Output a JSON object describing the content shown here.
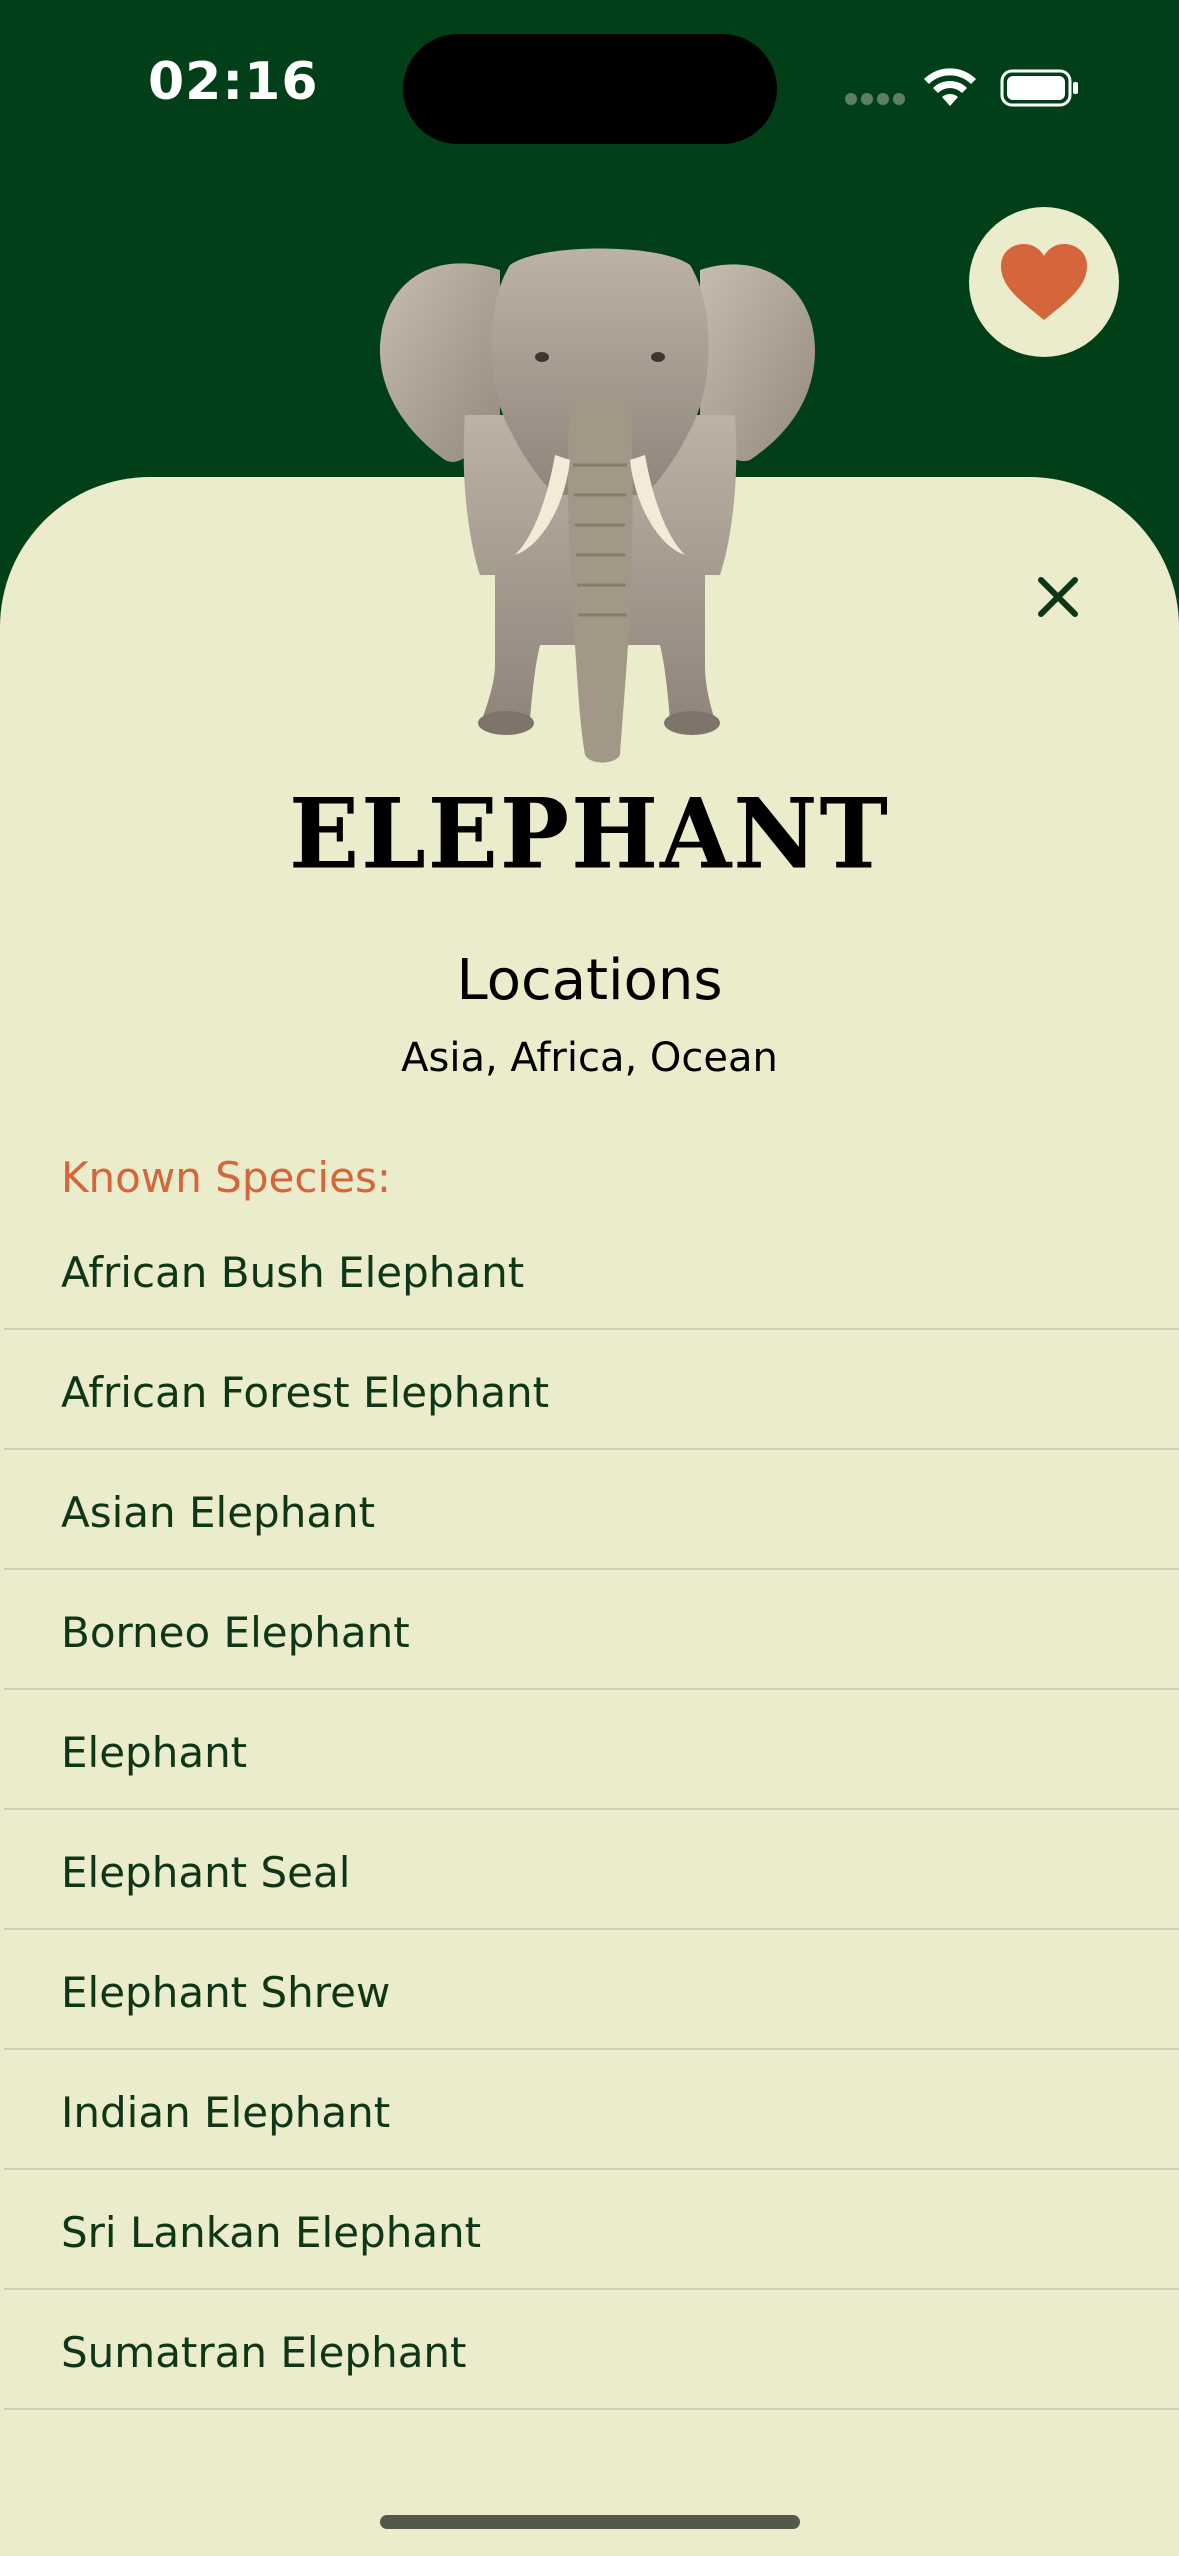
{
  "status_bar": {
    "time": "02:16"
  },
  "animal": {
    "name": "ELEPHANT",
    "image": "elephant-photo"
  },
  "locations": {
    "heading": "Locations",
    "value": "Asia, Africa, Ocean"
  },
  "species": {
    "heading": "Known Species:",
    "items": [
      "African Bush Elephant",
      "African Forest Elephant",
      "Asian Elephant",
      "Borneo Elephant",
      "Elephant",
      "Elephant Seal",
      "Elephant Shrew",
      "Indian Elephant",
      "Sri Lankan Elephant",
      "Sumatran Elephant"
    ]
  },
  "colors": {
    "header_bg": "#003f18",
    "sheet_bg": "#eaeccb",
    "accent": "#d5653a",
    "list_text": "#0f3616"
  },
  "icons": {
    "favorite": "heart-icon",
    "close": "close-icon",
    "wifi": "wifi-icon",
    "battery": "battery-icon"
  }
}
